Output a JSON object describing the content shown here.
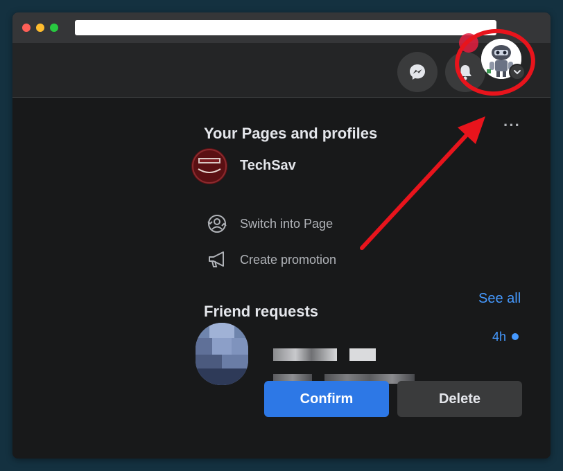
{
  "pages_section": {
    "title": "Your Pages and profiles",
    "more_label": "···",
    "page_name": "TechSav",
    "actions": [
      {
        "label": "Switch into Page",
        "icon": "switch-profile-icon"
      },
      {
        "label": "Create promotion",
        "icon": "megaphone-icon"
      }
    ]
  },
  "friend_requests": {
    "title": "Friend requests",
    "see_all": "See all",
    "request": {
      "time": "4h",
      "confirm_label": "Confirm",
      "delete_label": "Delete"
    }
  },
  "colors": {
    "accent": "#2d78e6",
    "link": "#4599ff",
    "annotation": "#e8141c"
  }
}
